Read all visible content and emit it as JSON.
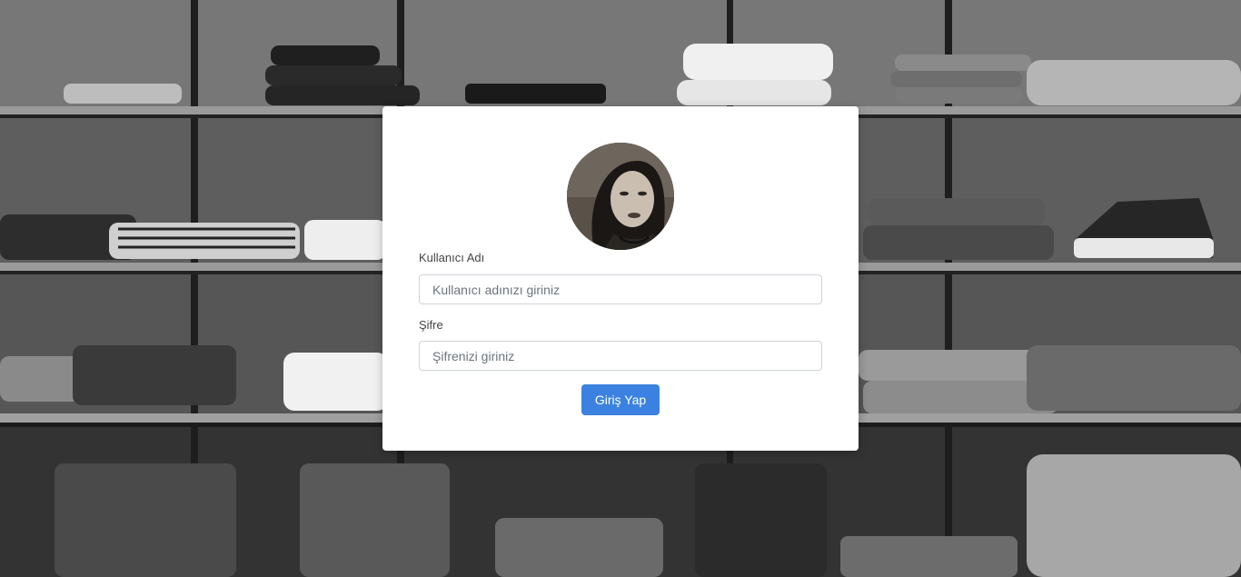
{
  "login": {
    "username_label": "Kullanıcı Adı",
    "username_placeholder": "Kullanıcı adınızı giriniz",
    "username_value": "",
    "password_label": "Şifre",
    "password_placeholder": "Şifrenizi giriniz",
    "password_value": "",
    "submit_label": "Giriş Yap"
  },
  "colors": {
    "button": "#3b82e0",
    "card": "#ffffff"
  },
  "icons": {
    "avatar": "user-avatar-photo"
  }
}
